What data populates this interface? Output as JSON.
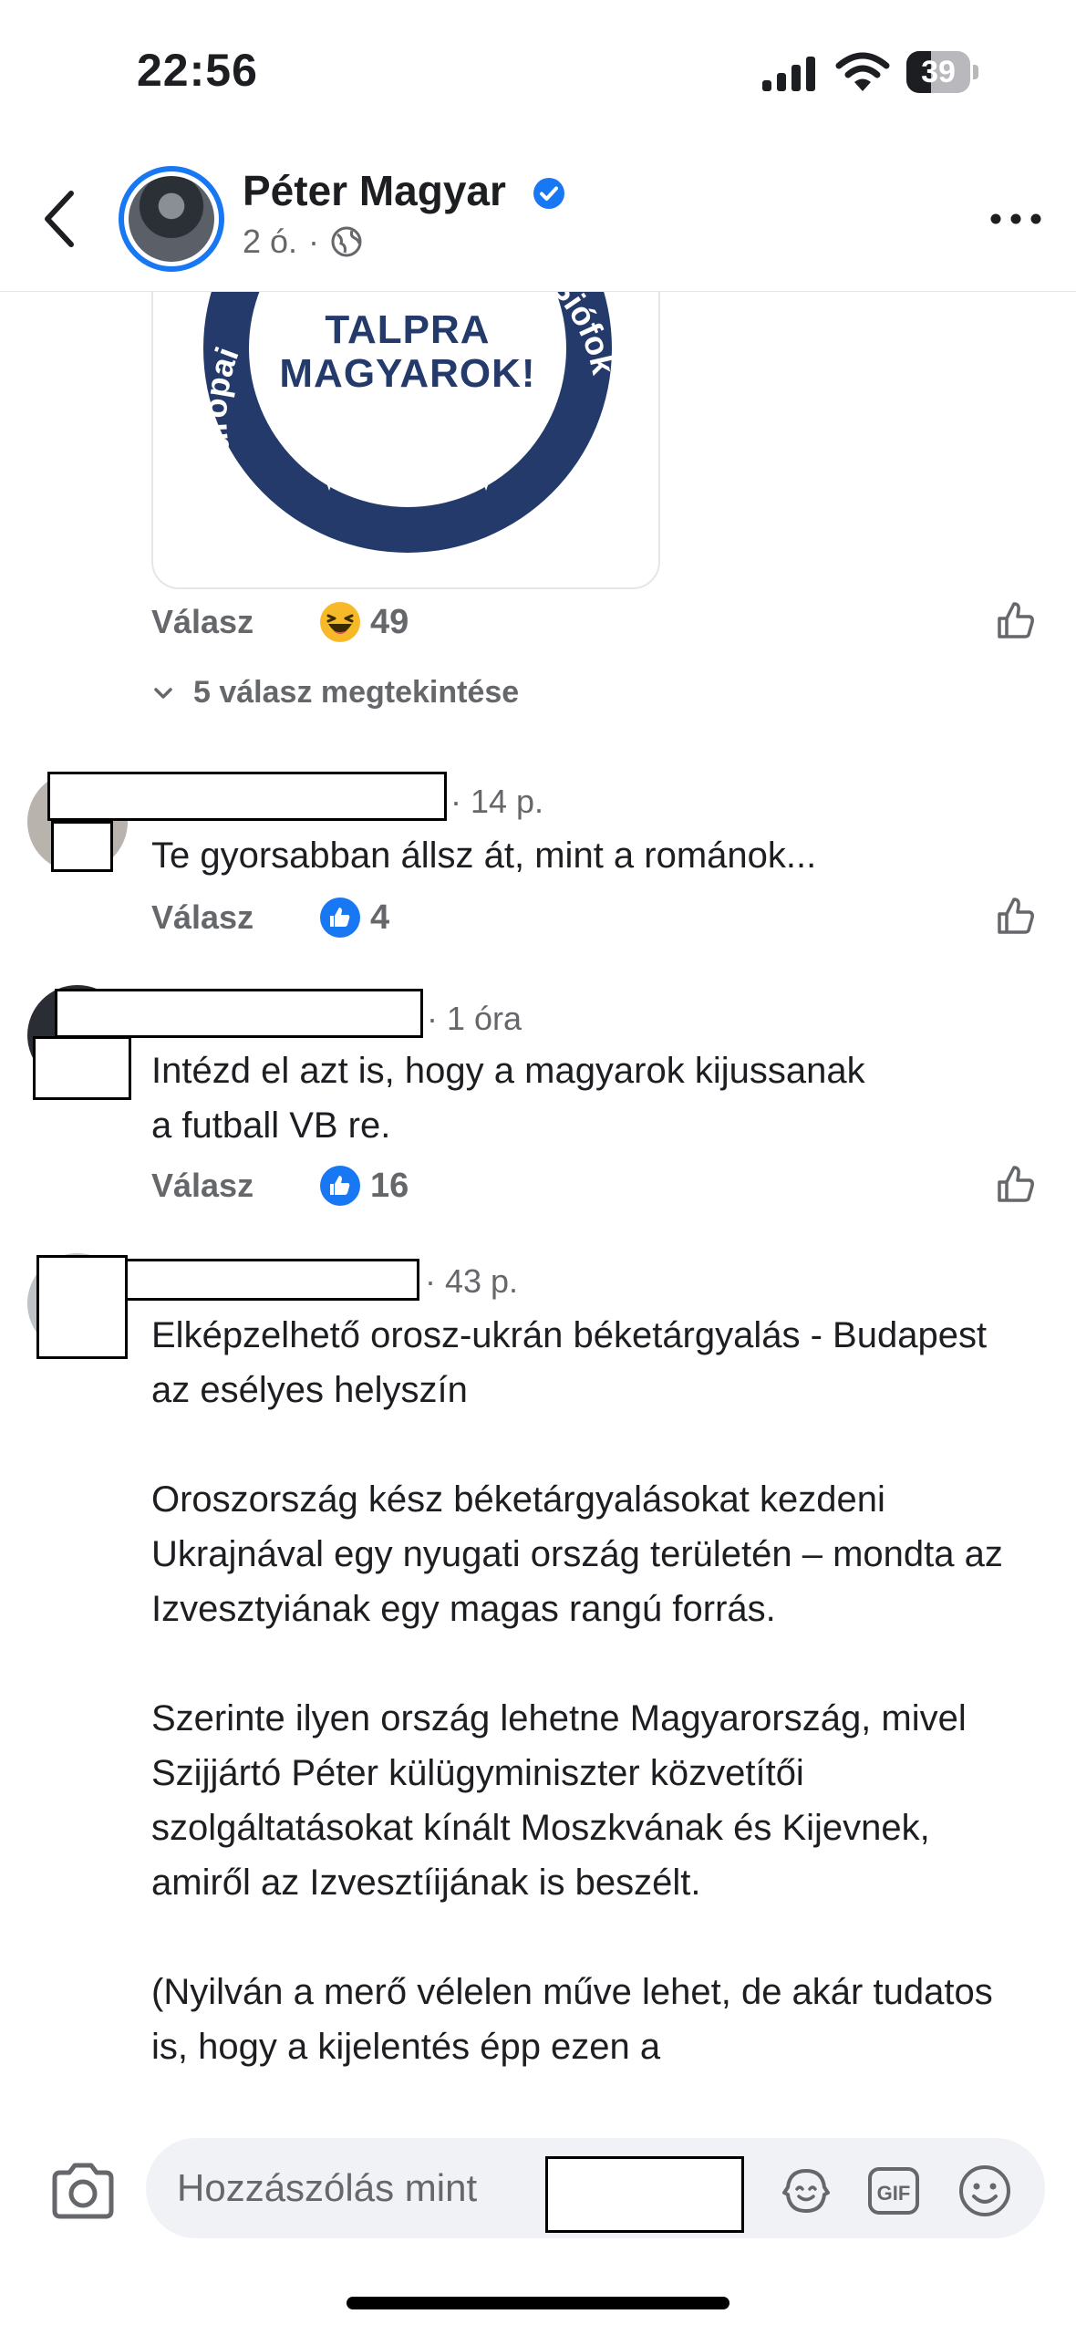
{
  "status_bar": {
    "time": "22:56",
    "battery": "39",
    "battery_level": 0.39,
    "icons": [
      "signal-icon",
      "wifi-icon",
      "battery-icon"
    ]
  },
  "header": {
    "page_name": "Péter Magyar",
    "time_ago": "2 ó.",
    "separator": "·",
    "icons": [
      "back-arrow-icon",
      "verified-badge-icon",
      "globe-icon",
      "more-options-icon"
    ]
  },
  "image_card": {
    "badge_center": [
      "TALPRA",
      "MAGYAROK!"
    ],
    "badge_ring_left": "Európai",
    "badge_ring_right": "t Siófok"
  },
  "first_comment_actions": {
    "reply": "Válasz",
    "reaction_count": "49",
    "reaction_icon": "haha-emoji-icon"
  },
  "view_replies": "5 válasz megtekintése",
  "comments": [
    {
      "time": "· 14 p.",
      "text": "Te gyorsabban állsz át, mint a románok...",
      "reply": "Válasz",
      "likes": "4"
    },
    {
      "time": "· 1 óra",
      "text": "Intézd el azt is, hogy a magyarok kijussanak\na futball VB re.",
      "reply": "Válasz",
      "likes": "16"
    },
    {
      "time": "· 43 p.",
      "paragraphs": [
        "Elképzelhető orosz-ukrán béketárgyalás - Budapest az esélyes helyszín",
        "Oroszország kész béketárgyalásokat kezdeni Ukrajnával egy nyugati ország területén – mondta az Izvesztyiának egy magas rangú forrás.",
        "Szerinte ilyen ország lehetne Magyarország, mivel Szijjártó Péter külügyminiszter közvetítői szolgáltatásokat kínált Moszkvának és Kijevnek, amiről az Izvesztíijának is beszélt.",
        "(Nyilván a merő vélelen műve lehet, de akár tudatos is, hogy a kijelentés épp ezen a"
      ]
    }
  ],
  "composer": {
    "placeholder": "Hozzászólás mint",
    "gif_label": "GIF",
    "icons": [
      "camera-icon",
      "avatar-sticker-icon",
      "gif-icon",
      "emoji-icon"
    ]
  },
  "colors": {
    "accent": "#1877f2",
    "secondary_text": "#65676b",
    "like_blue": "#1877f2"
  }
}
